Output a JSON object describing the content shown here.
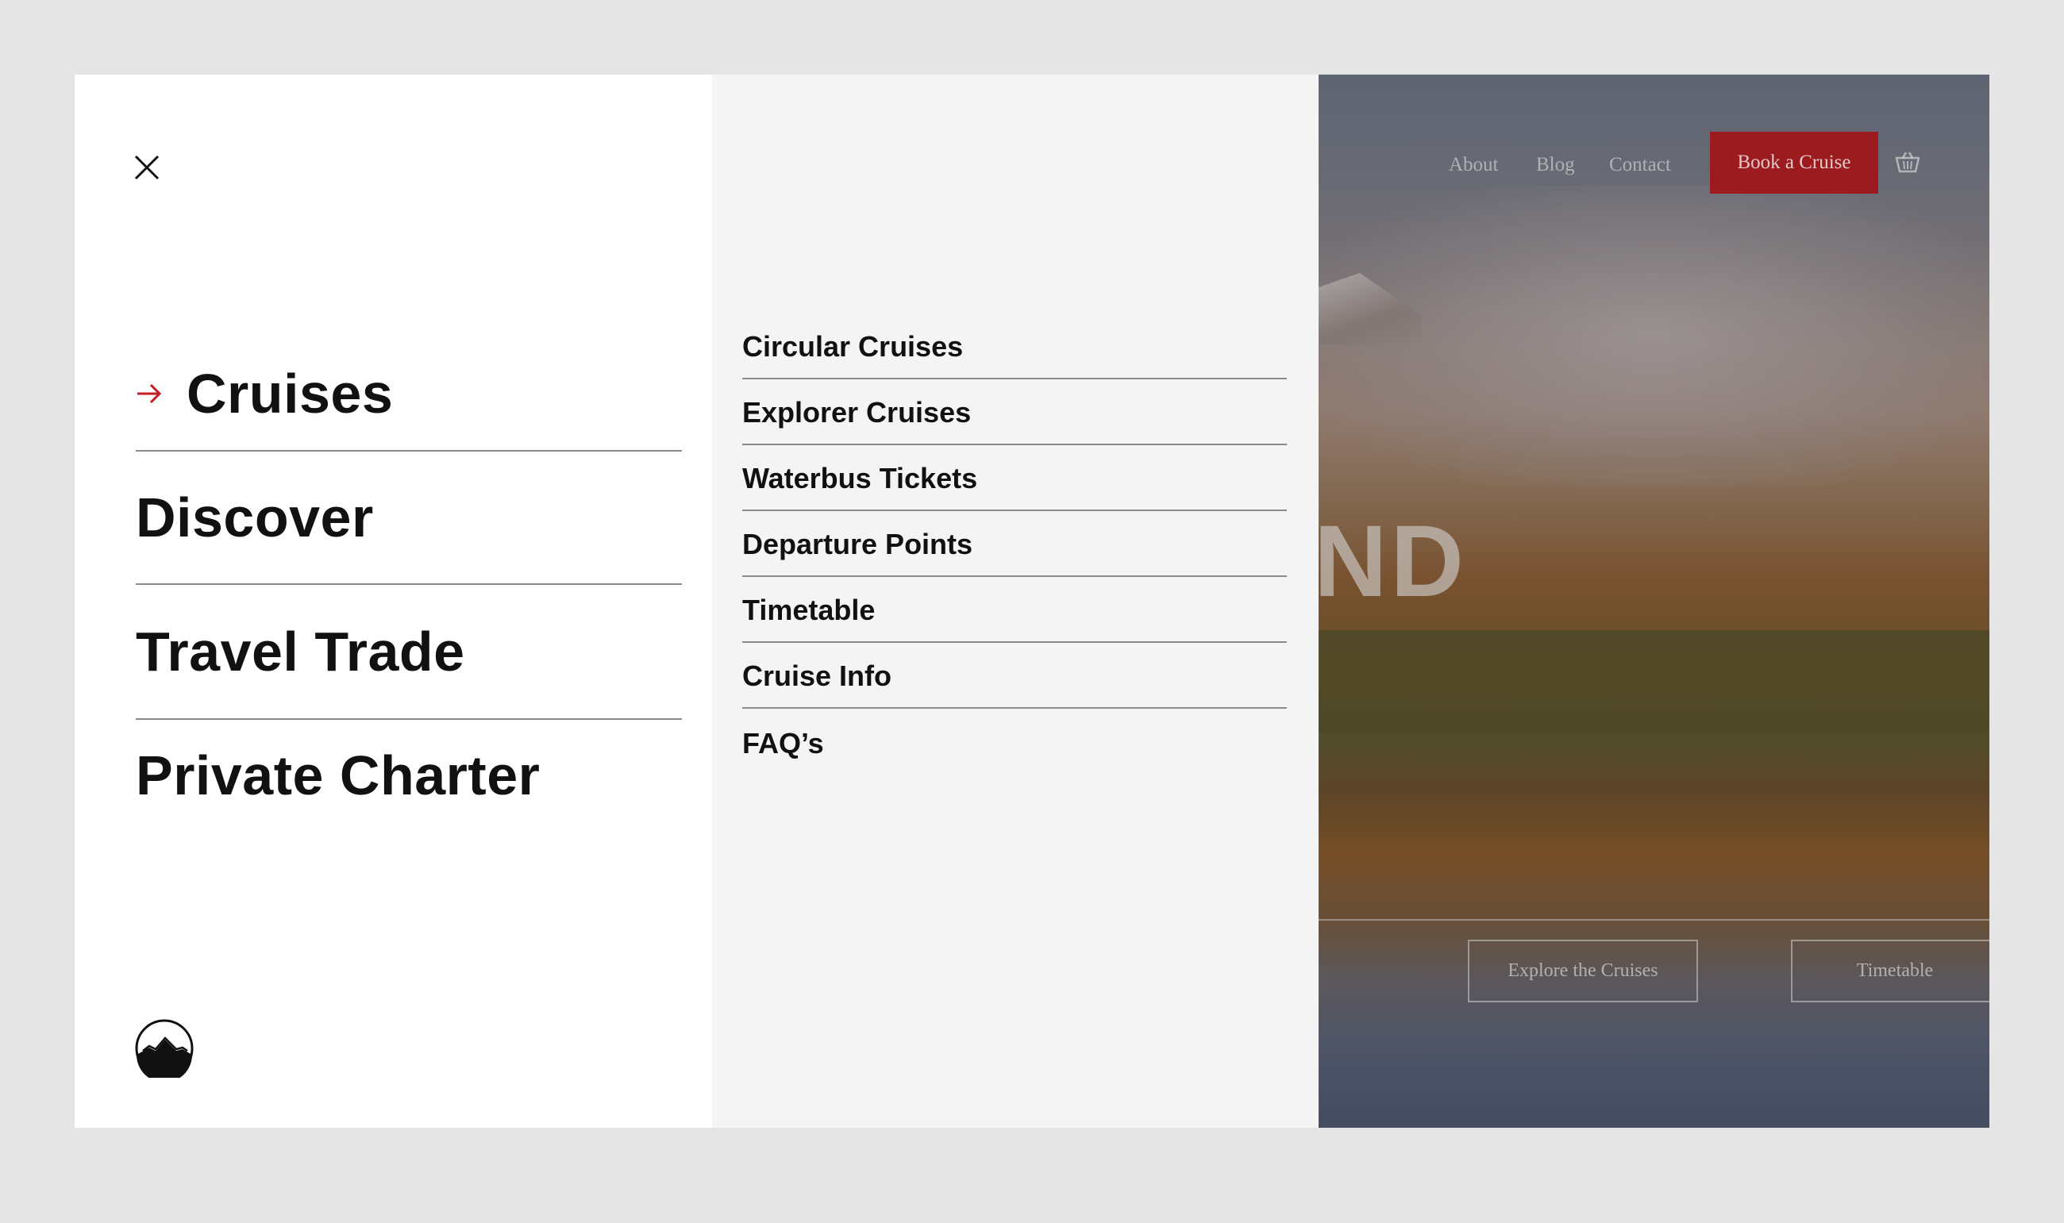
{
  "menu": {
    "close_icon": "close-icon",
    "items": [
      {
        "label": "Cruises",
        "active": true
      },
      {
        "label": "Discover"
      },
      {
        "label": "Travel Trade"
      },
      {
        "label": "Private Charter"
      }
    ],
    "active_color": "#c41e24"
  },
  "submenu": {
    "items": [
      {
        "label": "Circular Cruises"
      },
      {
        "label": "Explorer Cruises"
      },
      {
        "label": "Waterbus Tickets"
      },
      {
        "label": "Departure Points"
      },
      {
        "label": "Timetable"
      },
      {
        "label": "Cruise Info"
      },
      {
        "label": "FAQ’s"
      }
    ]
  },
  "hero": {
    "title_fragment": "ND",
    "nav": {
      "about": "About",
      "blog": "Blog",
      "contact": "Contact",
      "book": "Book a Cruise",
      "basket_icon": "basket-icon"
    },
    "buttons": {
      "explore": "Explore the Cruises",
      "timetable": "Timetable"
    },
    "brand_color": "#9b1b1f"
  }
}
